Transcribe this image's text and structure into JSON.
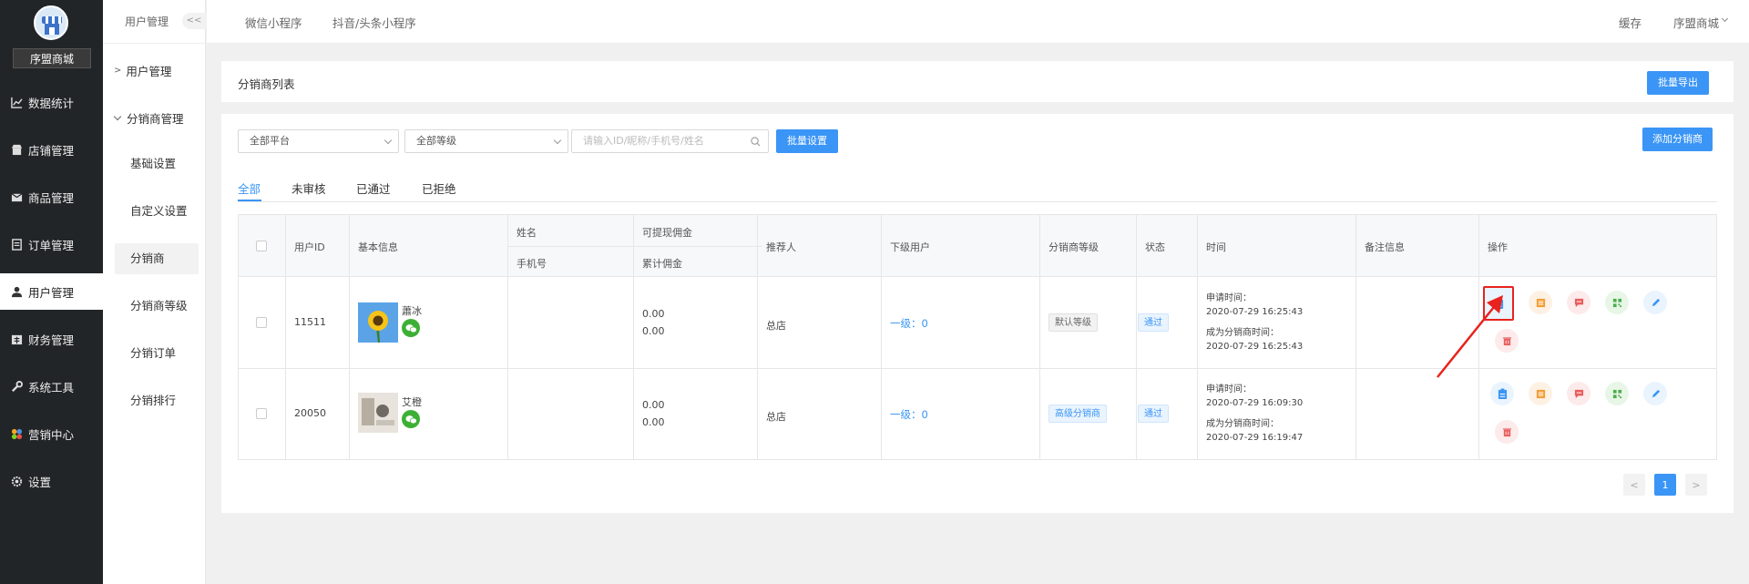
{
  "brand": {
    "name": "序盟商城"
  },
  "nav": [
    {
      "label": "数据统计",
      "icon": "chart-icon"
    },
    {
      "label": "店铺管理",
      "icon": "shop-icon"
    },
    {
      "label": "商品管理",
      "icon": "box-icon"
    },
    {
      "label": "订单管理",
      "icon": "order-icon"
    },
    {
      "label": "用户管理",
      "icon": "user-icon"
    },
    {
      "label": "财务管理",
      "icon": "finance-icon"
    },
    {
      "label": "系统工具",
      "icon": "wrench-icon"
    },
    {
      "label": "营销中心",
      "icon": "marketing-icon"
    },
    {
      "label": "设置",
      "icon": "gear-icon"
    }
  ],
  "subnav": {
    "title": "用户管理",
    "collapse": "<<",
    "group1": "用户管理",
    "group2": "分销商管理",
    "items": [
      "基础设置",
      "自定义设置",
      "分销商",
      "分销商等级",
      "分销订单",
      "分销排行"
    ]
  },
  "topbar": {
    "links": [
      "微信小程序",
      "抖音/头条小程序"
    ],
    "cache": "缓存",
    "user": "序盟商城"
  },
  "page": {
    "title": "分销商列表",
    "export": "批量导出"
  },
  "filters": {
    "platform": "全部平台",
    "level": "全部等级",
    "search_placeholder": "请输入ID/昵称/手机号/姓名",
    "batch": "批量设置",
    "add": "添加分销商"
  },
  "tabs": [
    "全部",
    "未审核",
    "已通过",
    "已拒绝"
  ],
  "table": {
    "headers": {
      "uid": "用户ID",
      "basic": "基本信息",
      "name": "姓名",
      "phone": "手机号",
      "withdraw": "可提现佣金",
      "total": "累计佣金",
      "referrer": "推荐人",
      "sub": "下级用户",
      "level": "分销商等级",
      "status": "状态",
      "time": "时间",
      "remark": "备注信息",
      "ops": "操作"
    },
    "rows": [
      {
        "uid": "11511",
        "nick": "蕭冰",
        "withdraw": "0.00",
        "total": "0.00",
        "referrer": "总店",
        "sub": "一级：0",
        "level": "默认等级",
        "status": "通过",
        "apply_label": "申请时间：",
        "apply_time": "2020-07-29 16:25:43",
        "become_label": "成为分销商时间：",
        "become_time": "2020-07-29 16:25:43"
      },
      {
        "uid": "20050",
        "nick": "艾橙",
        "withdraw": "0.00",
        "total": "0.00",
        "referrer": "总店",
        "sub": "一级：0",
        "level": "高级分销商",
        "status": "通过",
        "apply_label": "申请时间：",
        "apply_time": "2020-07-29 16:09:30",
        "become_label": "成为分销商时间：",
        "become_time": "2020-07-29 16:19:47"
      }
    ]
  },
  "pagination": {
    "prev": "<",
    "page": "1",
    "next": ">"
  },
  "colors": {
    "primary": "#3a95f6",
    "sidebar": "#222527",
    "annotation": "#e8231e"
  }
}
